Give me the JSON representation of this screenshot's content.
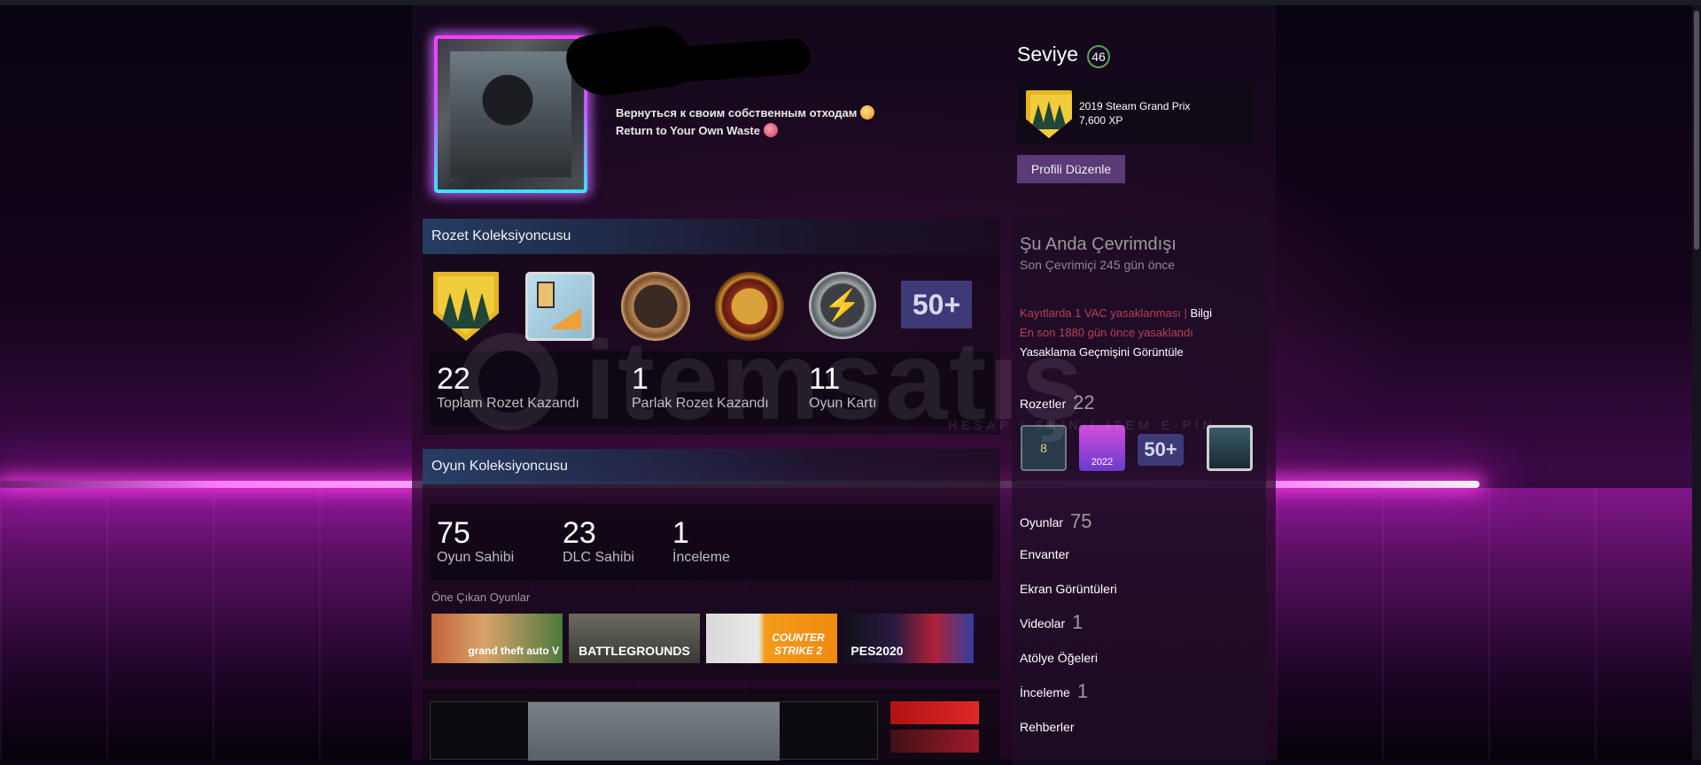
{
  "profile": {
    "summary_line1": "Вернуться к своим собственным отходам",
    "summary_line2": "Return to Your Own Waste"
  },
  "level": {
    "label": "Seviye",
    "value": "46"
  },
  "favorite_badge": {
    "name": "2019 Steam Grand Prix",
    "xp": "7,600 XP"
  },
  "edit_profile_label": "Profili Düzenle",
  "badge_collector": {
    "title": "Rozet Koleksiyoncusu",
    "more_label": "50+",
    "stats": [
      {
        "num": "22",
        "label": "Toplam Rozet Kazandı"
      },
      {
        "num": "1",
        "label": "Parlak Rozet Kazandı"
      },
      {
        "num": "11",
        "label": "Oyun Kartı"
      }
    ]
  },
  "game_collector": {
    "title": "Oyun Koleksiyoncusu",
    "stats": [
      {
        "num": "75",
        "label": "Oyun Sahibi"
      },
      {
        "num": "23",
        "label": "DLC Sahibi"
      },
      {
        "num": "1",
        "label": "İnceleme"
      }
    ],
    "featured_label": "Öne Çıkan Oyunlar",
    "featured": [
      {
        "name": "grand theft auto V"
      },
      {
        "name": "BATTLEGROUNDS"
      },
      {
        "name": "COUNTER STRIKE 2"
      },
      {
        "name": "PES2020"
      }
    ]
  },
  "status": {
    "title": "Şu Anda Çevrimdışı",
    "subtitle": "Son Çevrimiçi 245 gün önce",
    "vac_text": "Kayıtlarda 1 VAC yasaklanması | ",
    "vac_link": "Bilgi",
    "ban_ago": "En son 1880 gün önce yasaklandı",
    "ban_history": "Yasaklama Geçmişini Görüntüle"
  },
  "badges_link": {
    "label": "Rozetler",
    "count": "22",
    "small": [
      "8",
      "2022",
      "50+"
    ]
  },
  "links": [
    {
      "label": "Oyunlar",
      "count": "75"
    },
    {
      "label": "Envanter",
      "count": ""
    },
    {
      "label": "Ekran Görüntüleri",
      "count": ""
    },
    {
      "label": "Videolar",
      "count": "1"
    },
    {
      "label": "Atölye Öğeleri",
      "count": ""
    },
    {
      "label": "İnceleme",
      "count": "1"
    },
    {
      "label": "Rehberler",
      "count": ""
    }
  ],
  "watermark": {
    "word": "itemsatış",
    "tag": "HESAP / SKIN / ITEM E-PIN"
  },
  "colors": {
    "accent": "#5c3a78",
    "vac": "#b8405a",
    "neon_pink": "#ff3cff",
    "neon_cyan": "#36e6ff",
    "gold": "#e6b525"
  }
}
